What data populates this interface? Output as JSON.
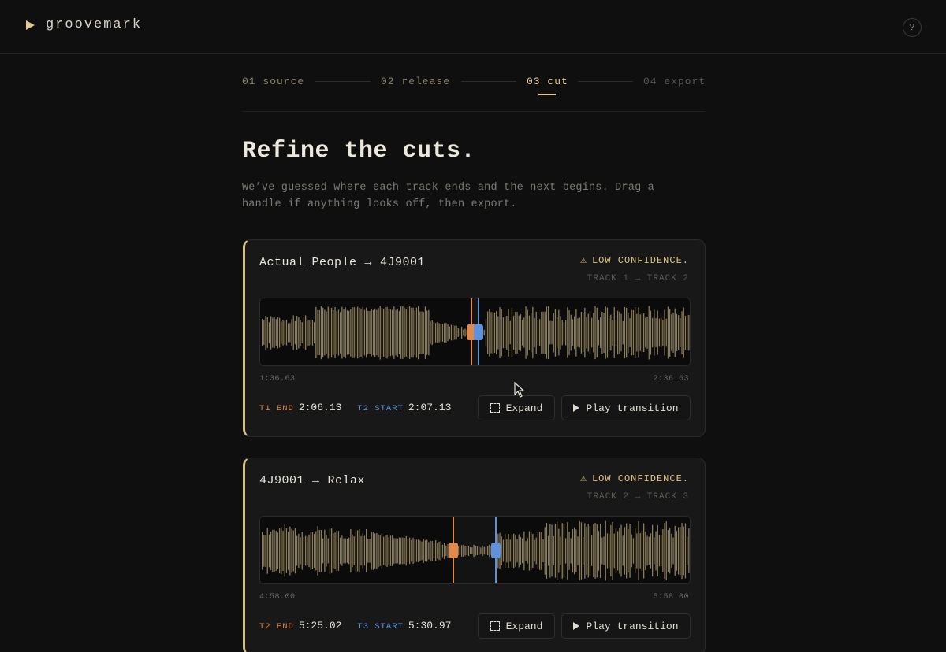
{
  "app": {
    "name": "groovemark",
    "help_label": "?"
  },
  "stepper": {
    "steps": [
      {
        "label": "01 source",
        "state": "done"
      },
      {
        "label": "02 release",
        "state": "done"
      },
      {
        "label": "03 cut",
        "state": "active"
      },
      {
        "label": "04 export",
        "state": "future"
      }
    ]
  },
  "page": {
    "title": "Refine the cuts.",
    "subtitle": "We’ve guessed where each track ends and the next begins. Drag a handle if anything looks off, then export."
  },
  "transitions": [
    {
      "from": "Actual People",
      "to": "4J9001",
      "warning": "LOW CONFIDENCE.",
      "tracks": "TRACK 1 → TRACK 2",
      "window_start": "1:36.63",
      "window_end": "2:36.63",
      "end_label": "T1 END",
      "end_value": "2:06.13",
      "start_label": "T2 START",
      "start_value": "2:07.13",
      "expand_label": "Expand",
      "play_label": "Play transition"
    },
    {
      "from": "4J9001",
      "to": "Relax",
      "warning": "LOW CONFIDENCE.",
      "tracks": "TRACK 2 → TRACK 3",
      "window_start": "4:58.00",
      "window_end": "5:58.00",
      "end_label": "T2 END",
      "end_value": "5:25.02",
      "start_label": "T3 START",
      "start_value": "5:30.97",
      "expand_label": "Expand",
      "play_label": "Play transition"
    }
  ],
  "colors": {
    "accent": "#e6c98a",
    "end_cut": "#e0894f",
    "start_cut": "#5f92dd",
    "waveform": "#8a7c5c"
  }
}
